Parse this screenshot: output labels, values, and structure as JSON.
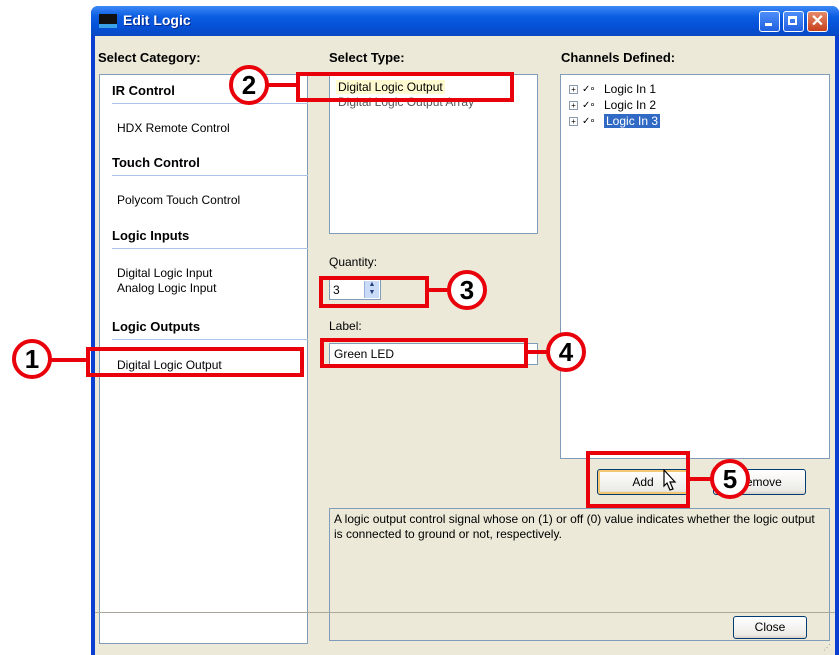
{
  "window": {
    "title": "Edit Logic"
  },
  "headers": {
    "category": "Select Category:",
    "type": "Select Type:",
    "channels": "Channels Defined:"
  },
  "categories": {
    "ir_control": {
      "title": "IR Control",
      "items": [
        "HDX Remote Control"
      ]
    },
    "touch_control": {
      "title": "Touch Control",
      "items": [
        "Polycom Touch Control"
      ]
    },
    "logic_inputs": {
      "title": "Logic Inputs",
      "items": [
        "Digital Logic Input",
        "Analog Logic Input"
      ]
    },
    "logic_outputs": {
      "title": "Logic Outputs",
      "items": [
        "Digital Logic Output"
      ]
    }
  },
  "types": [
    "Digital Logic Output",
    "Digital Logic Output Array"
  ],
  "quantity": {
    "label": "Quantity:",
    "value": "3"
  },
  "label_field": {
    "label": "Label:",
    "value": "Green LED"
  },
  "channels": [
    "Logic In 1",
    "Logic In 2",
    "Logic In 3"
  ],
  "buttons": {
    "add": "Add",
    "remove": "Remove",
    "close": "Close"
  },
  "description": "A logic output control signal whose on (1) or off (0) value indicates whether the logic output is connected to ground or not, respectively.",
  "annotations": [
    "1",
    "2",
    "3",
    "4",
    "5"
  ],
  "colors": {
    "callout_red": "#e8000a",
    "title_blue": "#0b5de2",
    "selection_blue": "#316ac5"
  }
}
